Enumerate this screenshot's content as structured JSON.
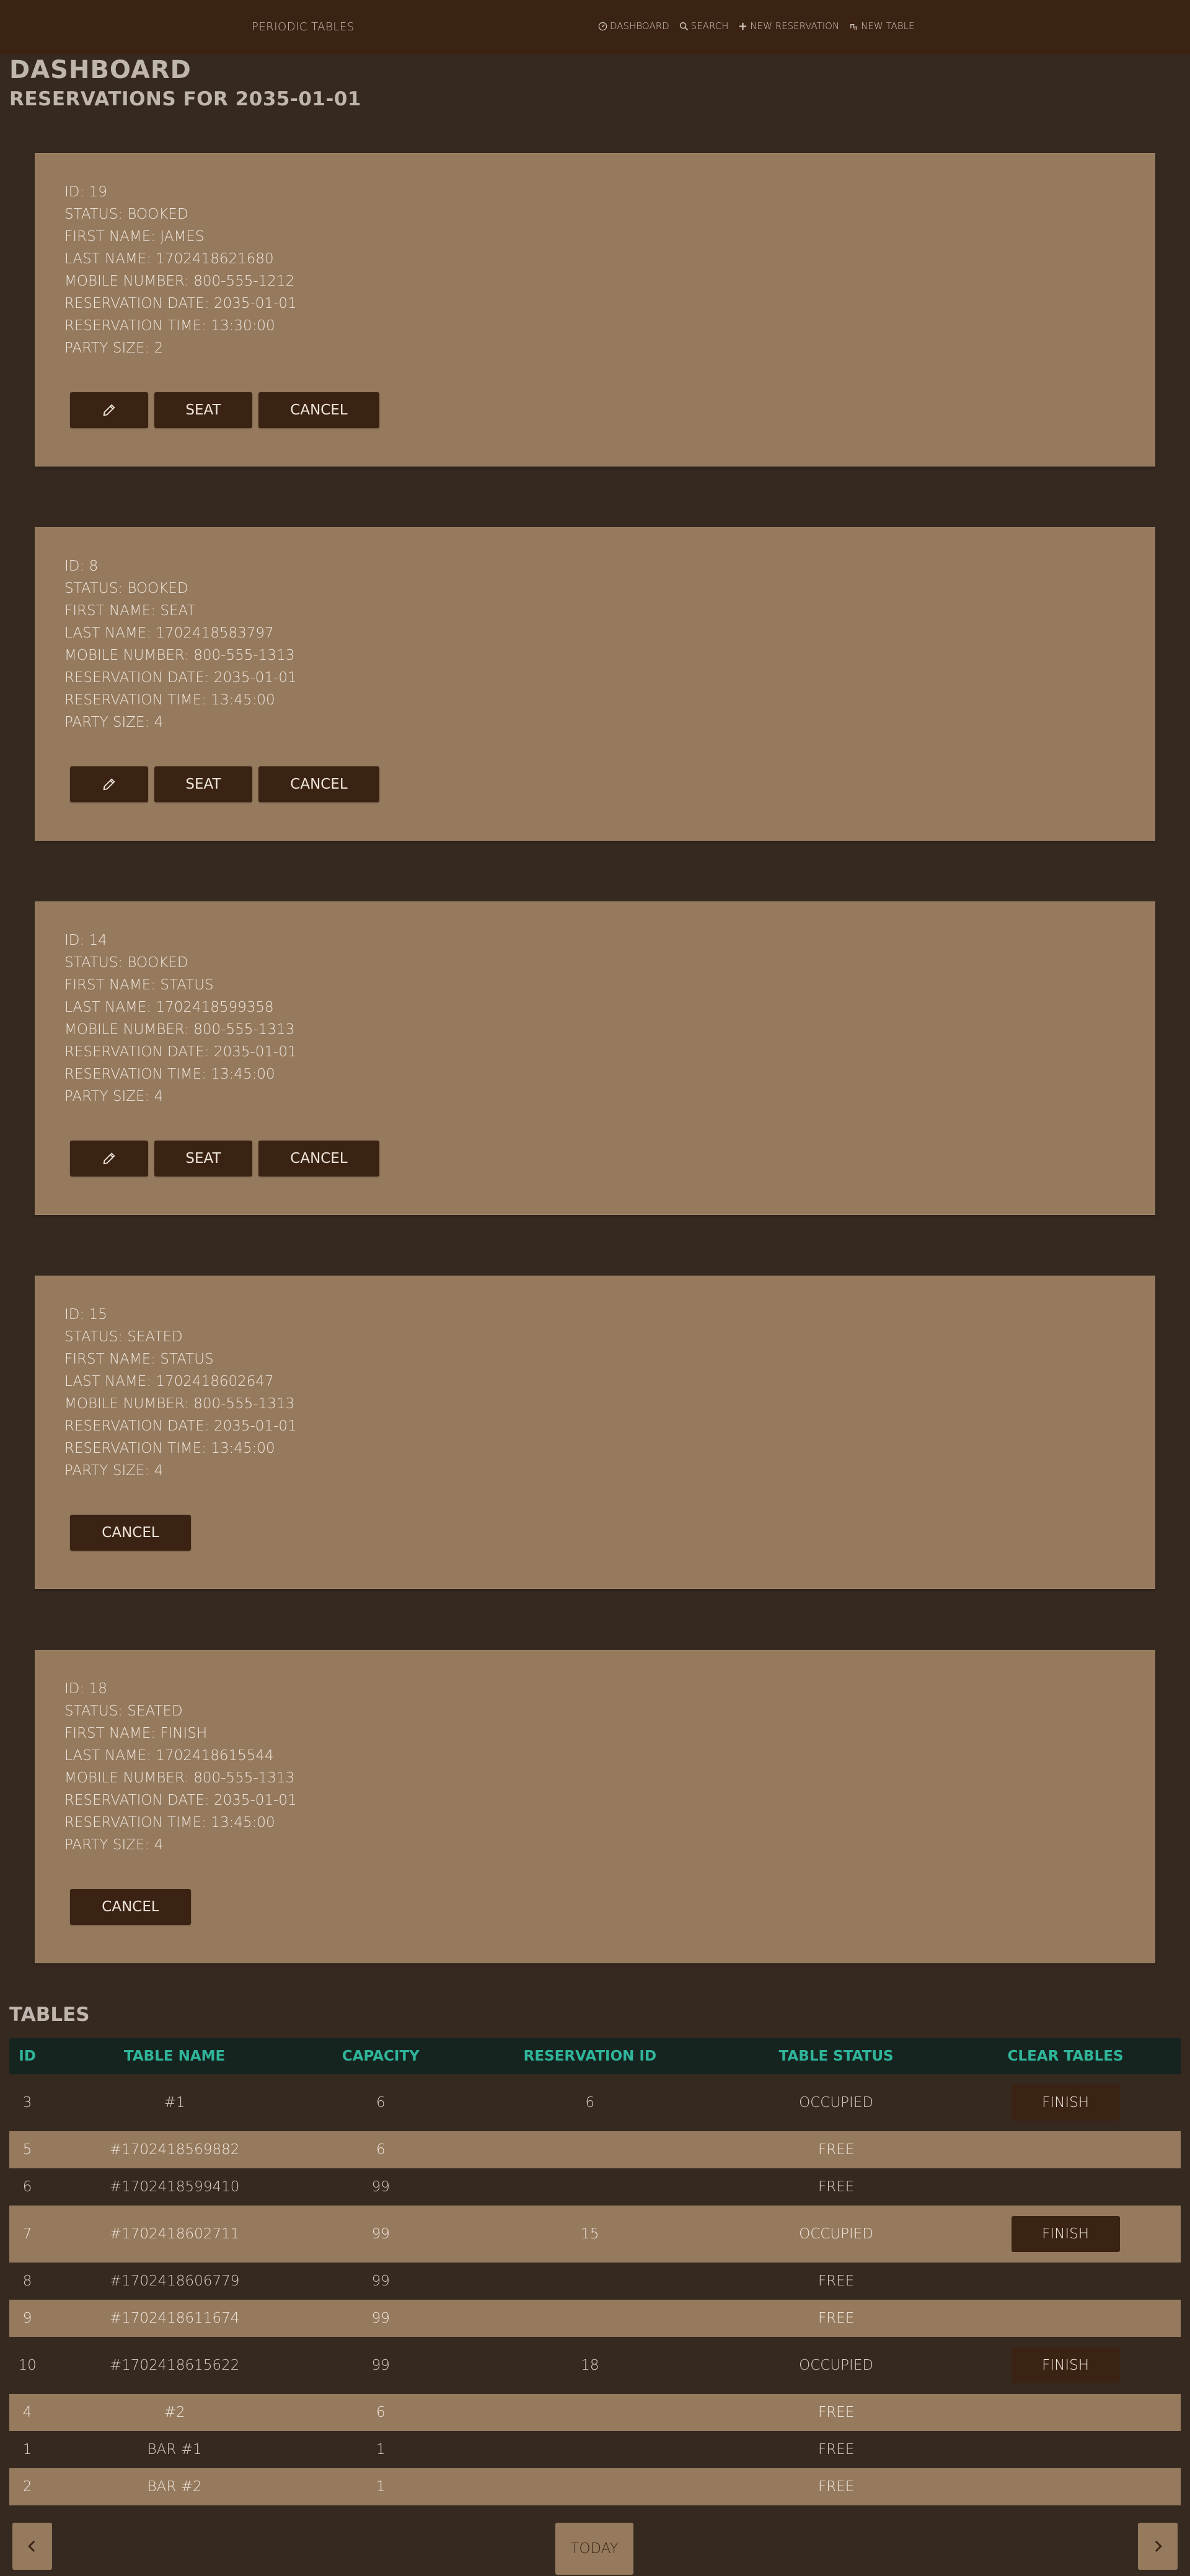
{
  "app": {
    "brand": "PERIODIC TABLES"
  },
  "nav": {
    "dashboard": "DASHBOARD",
    "search": "SEARCH",
    "new_reservation": "NEW RESERVATION",
    "new_table": "NEW TABLE"
  },
  "page": {
    "title": "DASHBOARD",
    "subtitle": "RESERVATIONS FOR 2035-01-01"
  },
  "labels": {
    "id": "ID: ",
    "status": "STATUS: ",
    "first_name": "FIRST NAME: ",
    "last_name": "LAST NAME: ",
    "mobile": "MOBILE NUMBER: ",
    "date": "RESERVATION DATE: ",
    "time": "RESERVATION TIME: ",
    "party": "PARTY SIZE: ",
    "seat": "SEAT",
    "cancel": "CANCEL",
    "finish": "FINISH"
  },
  "reservations": [
    {
      "id": "19",
      "status": "BOOKED",
      "first_name": "JAMES",
      "last_name": "1702418621680",
      "mobile": "800-555-1212",
      "date": "2035-01-01",
      "time": "13:30:00",
      "party": "2"
    },
    {
      "id": "8",
      "status": "BOOKED",
      "first_name": "SEAT",
      "last_name": "1702418583797",
      "mobile": "800-555-1313",
      "date": "2035-01-01",
      "time": "13:45:00",
      "party": "4"
    },
    {
      "id": "14",
      "status": "BOOKED",
      "first_name": "STATUS",
      "last_name": "1702418599358",
      "mobile": "800-555-1313",
      "date": "2035-01-01",
      "time": "13:45:00",
      "party": "4"
    },
    {
      "id": "15",
      "status": "SEATED",
      "first_name": "STATUS",
      "last_name": "1702418602647",
      "mobile": "800-555-1313",
      "date": "2035-01-01",
      "time": "13:45:00",
      "party": "4"
    },
    {
      "id": "18",
      "status": "SEATED",
      "first_name": "FINISH",
      "last_name": "1702418615544",
      "mobile": "800-555-1313",
      "date": "2035-01-01",
      "time": "13:45:00",
      "party": "4"
    }
  ],
  "tables": {
    "title": "TABLES",
    "headers": [
      "ID",
      "TABLE NAME",
      "CAPACITY",
      "RESERVATION ID",
      "TABLE STATUS",
      "CLEAR TABLES"
    ],
    "rows": [
      {
        "id": "3",
        "name": "#1",
        "capacity": "6",
        "reservation_id": "6",
        "status": "OCCUPIED"
      },
      {
        "id": "5",
        "name": "#1702418569882",
        "capacity": "6",
        "reservation_id": "",
        "status": "FREE"
      },
      {
        "id": "6",
        "name": "#1702418599410",
        "capacity": "99",
        "reservation_id": "",
        "status": "FREE"
      },
      {
        "id": "7",
        "name": "#1702418602711",
        "capacity": "99",
        "reservation_id": "15",
        "status": "OCCUPIED"
      },
      {
        "id": "8",
        "name": "#1702418606779",
        "capacity": "99",
        "reservation_id": "",
        "status": "FREE"
      },
      {
        "id": "9",
        "name": "#1702418611674",
        "capacity": "99",
        "reservation_id": "",
        "status": "FREE"
      },
      {
        "id": "10",
        "name": "#1702418615622",
        "capacity": "99",
        "reservation_id": "18",
        "status": "OCCUPIED"
      },
      {
        "id": "4",
        "name": "#2",
        "capacity": "6",
        "reservation_id": "",
        "status": "FREE"
      },
      {
        "id": "1",
        "name": "BAR #1",
        "capacity": "1",
        "reservation_id": "",
        "status": "FREE"
      },
      {
        "id": "2",
        "name": "BAR #2",
        "capacity": "1",
        "reservation_id": "",
        "status": "FREE"
      }
    ]
  },
  "pager": {
    "today": "TODAY"
  }
}
